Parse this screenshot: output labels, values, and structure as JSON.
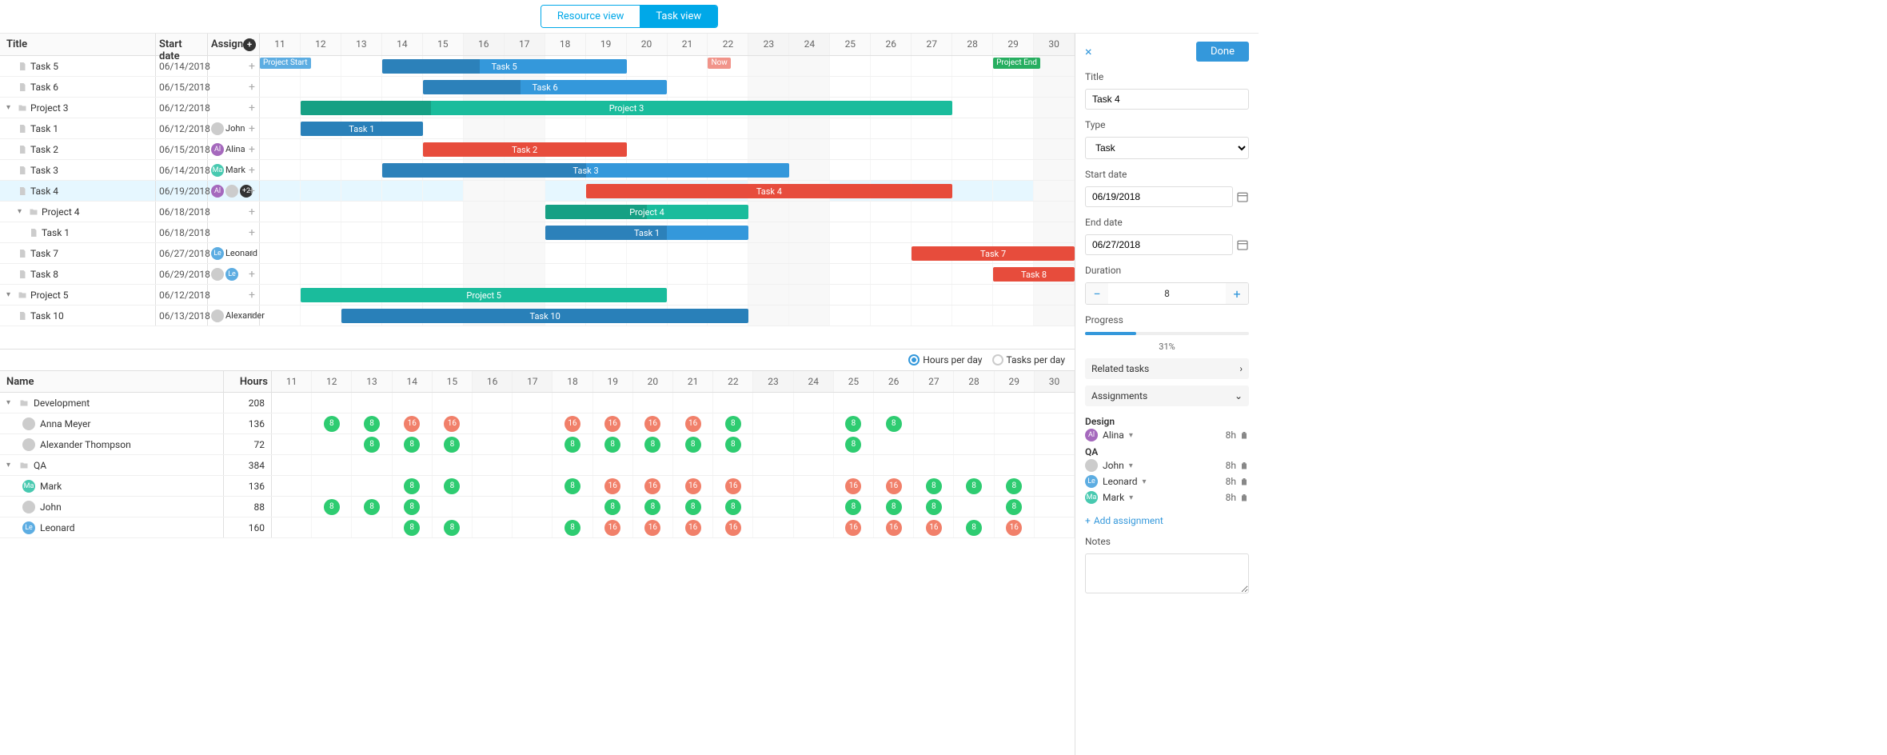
{
  "view": {
    "resource": "Resource view",
    "task": "Task view",
    "active": "task"
  },
  "columns": {
    "title": "Title",
    "start": "Start date",
    "assigned": "Assigned"
  },
  "days": [
    11,
    12,
    13,
    14,
    15,
    16,
    17,
    18,
    19,
    20,
    21,
    22,
    23,
    24,
    25,
    26,
    27,
    28,
    29,
    30
  ],
  "weekend_days": [
    16,
    17,
    23,
    24,
    30
  ],
  "markers": {
    "project_start": "Project Start",
    "project_end": "Project End",
    "now": "Now"
  },
  "tasks": [
    {
      "name": "Task 5",
      "start": "06/14/2018",
      "indent": 1,
      "bar": {
        "from": 14,
        "to": 19,
        "color": "blue",
        "label": "Task 5",
        "progress": 0.4
      }
    },
    {
      "name": "Task 6",
      "start": "06/15/2018",
      "indent": 1,
      "bar": {
        "from": 15,
        "to": 20,
        "color": "blue",
        "label": "Task 6",
        "progress": 0.4
      }
    },
    {
      "name": "Project 3",
      "start": "06/12/2018",
      "indent": 0,
      "folder": true,
      "bar": {
        "from": 12,
        "to": 27,
        "color": "teal",
        "label": "Project 3",
        "progress": 0.2
      }
    },
    {
      "name": "Task 1",
      "start": "06/12/2018",
      "indent": 1,
      "assigned": [
        {
          "type": "photo",
          "name": "John"
        }
      ],
      "assigned_label": "John",
      "bar": {
        "from": 12,
        "to": 14,
        "color": "blue-dark",
        "label": "Task 1"
      }
    },
    {
      "name": "Task 2",
      "start": "06/15/2018",
      "indent": 1,
      "assigned": [
        {
          "type": "purple",
          "name": "Alina",
          "ini": "Al"
        }
      ],
      "assigned_label": "Alina",
      "bar": {
        "from": 15,
        "to": 19,
        "color": "red",
        "label": "Task 2"
      }
    },
    {
      "name": "Task 3",
      "start": "06/14/2018",
      "indent": 1,
      "assigned": [
        {
          "type": "teal",
          "name": "Mark",
          "ini": "Ma"
        }
      ],
      "assigned_label": "Mark",
      "bar": {
        "from": 14,
        "to": 23,
        "color": "blue",
        "label": "Task 3",
        "progress": 0.5
      }
    },
    {
      "name": "Task 4",
      "start": "06/19/2018",
      "indent": 1,
      "selected": true,
      "assigned": [
        {
          "type": "purple",
          "ini": "Al"
        },
        {
          "type": "photo"
        },
        {
          "type": "badge",
          "ini": "+2"
        }
      ],
      "bar": {
        "from": 19,
        "to": 27,
        "color": "red",
        "label": "Task 4"
      }
    },
    {
      "name": "Project 4",
      "start": "06/18/2018",
      "indent": 1,
      "folder": true,
      "bar": {
        "from": 18,
        "to": 22,
        "color": "teal",
        "label": "Project 4",
        "progress": 0.5
      }
    },
    {
      "name": "Task 1",
      "start": "06/18/2018",
      "indent": 2,
      "bar": {
        "from": 18,
        "to": 22,
        "color": "blue",
        "label": "Task 1",
        "progress": 0.6
      }
    },
    {
      "name": "Task 7",
      "start": "06/27/2018",
      "indent": 1,
      "assigned": [
        {
          "type": "blue",
          "name": "Leonard",
          "ini": "Le"
        }
      ],
      "assigned_label": "Leonard",
      "bar": {
        "from": 27,
        "to": 30,
        "color": "red",
        "label": "Task 7"
      }
    },
    {
      "name": "Task 8",
      "start": "06/29/2018",
      "indent": 1,
      "assigned": [
        {
          "type": "photo"
        },
        {
          "type": "blue",
          "ini": "Le"
        }
      ],
      "bar": {
        "from": 29,
        "to": 30,
        "color": "red",
        "label": "Task 8"
      }
    },
    {
      "name": "Project 5",
      "start": "06/12/2018",
      "indent": 0,
      "folder": true,
      "bar": {
        "from": 12,
        "to": 20,
        "color": "teal",
        "label": "Project 5"
      }
    },
    {
      "name": "Task 10",
      "start": "06/13/2018",
      "indent": 1,
      "assigned": [
        {
          "type": "photo",
          "name": "Alexander"
        }
      ],
      "assigned_label": "Alexander",
      "bar": {
        "from": 13,
        "to": 22,
        "color": "blue-dark",
        "label": "Task 10"
      }
    }
  ],
  "resource_toggle": {
    "hours": "Hours per day",
    "tasks": "Tasks per day",
    "active": "hours"
  },
  "resource_columns": {
    "name": "Name",
    "hours": "Hours"
  },
  "resources": [
    {
      "name": "Development",
      "hours": 208,
      "folder": true
    },
    {
      "name": "Anna Meyer",
      "hours": 136,
      "avatar": {
        "type": "photo"
      },
      "loads": {
        "12": "8g",
        "13": "8g",
        "14": "16r",
        "15": "16r",
        "18": "16r",
        "19": "16r",
        "20": "16r",
        "21": "16r",
        "22": "8g",
        "25": "8g",
        "26": "8g"
      }
    },
    {
      "name": "Alexander Thompson",
      "hours": 72,
      "avatar": {
        "type": "photo"
      },
      "loads": {
        "13": "8g",
        "14": "8g",
        "15": "8g",
        "18": "8g",
        "19": "8g",
        "20": "8g",
        "21": "8g",
        "22": "8g",
        "25": "8g"
      }
    },
    {
      "name": "QA",
      "hours": 384,
      "folder": true
    },
    {
      "name": "Mark",
      "hours": 136,
      "avatar": {
        "type": "teal",
        "ini": "Ma"
      },
      "loads": {
        "14": "8g",
        "15": "8g",
        "18": "8g",
        "19": "16r",
        "20": "16r",
        "21": "16r",
        "22": "16r",
        "25": "16r",
        "26": "16r",
        "27": "8g",
        "28": "8g",
        "29": "8g"
      }
    },
    {
      "name": "John",
      "hours": 88,
      "avatar": {
        "type": "photo"
      },
      "loads": {
        "12": "8g",
        "13": "8g",
        "14": "8g",
        "19": "8g",
        "20": "8g",
        "21": "8g",
        "22": "8g",
        "25": "8g",
        "26": "8g",
        "27": "8g",
        "29": "8g"
      }
    },
    {
      "name": "Leonard",
      "hours": 160,
      "avatar": {
        "type": "blue",
        "ini": "Le"
      },
      "loads": {
        "14": "8g",
        "15": "8g",
        "18": "8g",
        "19": "16r",
        "20": "16r",
        "21": "16r",
        "22": "16r",
        "25": "16r",
        "26": "16r",
        "27": "16r",
        "28": "8g",
        "29": "16r"
      }
    }
  ],
  "panel": {
    "done": "Done",
    "title_label": "Title",
    "title_value": "Task 4",
    "type_label": "Type",
    "type_value": "Task",
    "start_label": "Start date",
    "start_value": "06/19/2018",
    "end_label": "End date",
    "end_value": "06/27/2018",
    "duration_label": "Duration",
    "duration_value": "8",
    "progress_label": "Progress",
    "progress_pct": "31%",
    "related_label": "Related tasks",
    "assignments_label": "Assignments",
    "groups": [
      {
        "label": "Design",
        "people": [
          {
            "name": "Alina",
            "avatar": {
              "type": "purple",
              "ini": "Al"
            },
            "hours": "8h"
          }
        ]
      },
      {
        "label": "QA",
        "people": [
          {
            "name": "John",
            "avatar": {
              "type": "photo"
            },
            "hours": "8h"
          },
          {
            "name": "Leonard",
            "avatar": {
              "type": "blue",
              "ini": "Le"
            },
            "hours": "8h"
          },
          {
            "name": "Mark",
            "avatar": {
              "type": "teal",
              "ini": "Ma"
            },
            "hours": "8h"
          }
        ]
      }
    ],
    "add_assignment": "Add assignment",
    "notes_label": "Notes"
  }
}
